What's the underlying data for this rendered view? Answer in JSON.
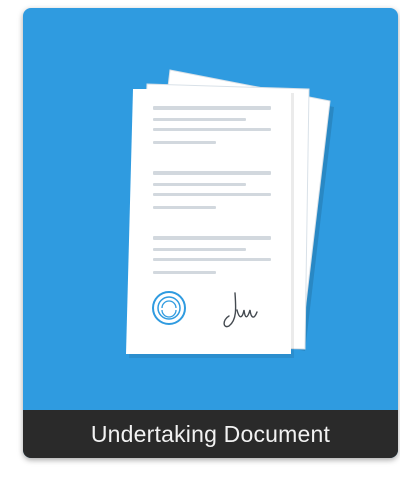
{
  "card": {
    "title": "Undertaking Document",
    "icon": "signed-documents-icon",
    "colors": {
      "background": "#2f9be0",
      "caption_bar": "#2a2a2a",
      "caption_text": "#f2f2f2",
      "paper": "#ffffff",
      "text_lines": "#d2d8de",
      "stamp": "#2f9be0"
    }
  }
}
